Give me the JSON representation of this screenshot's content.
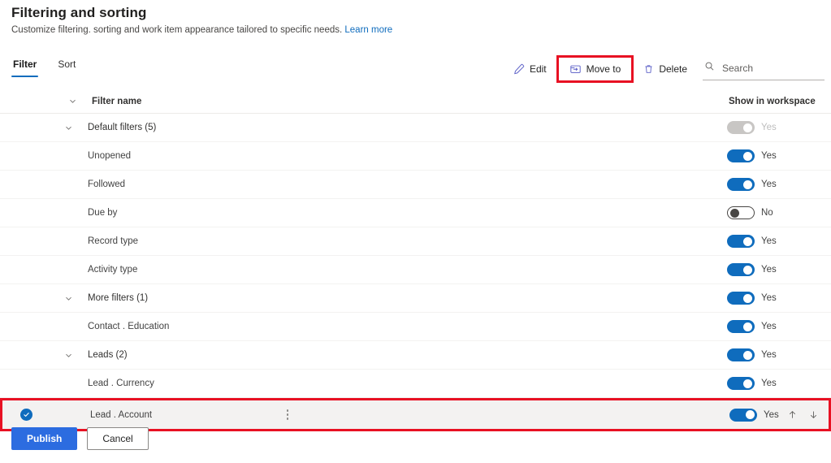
{
  "header": {
    "title": "Filtering and sorting",
    "subtitle": "Customize filtering. sorting and work item appearance tailored to specific needs.",
    "learn_more": "Learn more"
  },
  "tabs": [
    {
      "label": "Filter",
      "active": true
    },
    {
      "label": "Sort",
      "active": false
    }
  ],
  "commandbar": {
    "edit_label": "Edit",
    "move_to_label": "Move to",
    "delete_label": "Delete",
    "search_placeholder": "Search",
    "search_value": "",
    "highlight_color": "#e81123"
  },
  "grid": {
    "columns": {
      "filter_name": "Filter name",
      "show_in_workspace": "Show in workspace"
    },
    "rows": [
      {
        "label": "Default filters (5)",
        "type": "group",
        "toggle": "yes",
        "toggle_label": "Yes",
        "state": "disabled",
        "selected": false
      },
      {
        "label": "Unopened",
        "type": "child",
        "toggle": "yes",
        "toggle_label": "Yes",
        "state": "on",
        "selected": false
      },
      {
        "label": "Followed",
        "type": "child",
        "toggle": "yes",
        "toggle_label": "Yes",
        "state": "on",
        "selected": false
      },
      {
        "label": "Due by",
        "type": "child",
        "toggle": "no",
        "toggle_label": "No",
        "state": "off",
        "selected": false
      },
      {
        "label": "Record type",
        "type": "child",
        "toggle": "yes",
        "toggle_label": "Yes",
        "state": "on",
        "selected": false
      },
      {
        "label": "Activity type",
        "type": "child",
        "toggle": "yes",
        "toggle_label": "Yes",
        "state": "on",
        "selected": false
      },
      {
        "label": "More filters (1)",
        "type": "group",
        "toggle": "yes",
        "toggle_label": "Yes",
        "state": "on",
        "selected": false
      },
      {
        "label": "Contact . Education",
        "type": "child",
        "toggle": "yes",
        "toggle_label": "Yes",
        "state": "on",
        "selected": false
      },
      {
        "label": "Leads (2)",
        "type": "group",
        "toggle": "yes",
        "toggle_label": "Yes",
        "state": "on",
        "selected": false
      },
      {
        "label": "Lead . Currency",
        "type": "child",
        "toggle": "yes",
        "toggle_label": "Yes",
        "state": "on",
        "selected": false
      },
      {
        "label": "Lead . Account",
        "type": "child",
        "toggle": "yes",
        "toggle_label": "Yes",
        "state": "on",
        "selected": true
      }
    ]
  },
  "footer": {
    "publish_label": "Publish",
    "cancel_label": "Cancel"
  },
  "colors": {
    "accent": "#0f6cbd",
    "primary_button": "#2c6ce0",
    "highlight": "#e81123",
    "selected_row": "#f3f2f1"
  }
}
